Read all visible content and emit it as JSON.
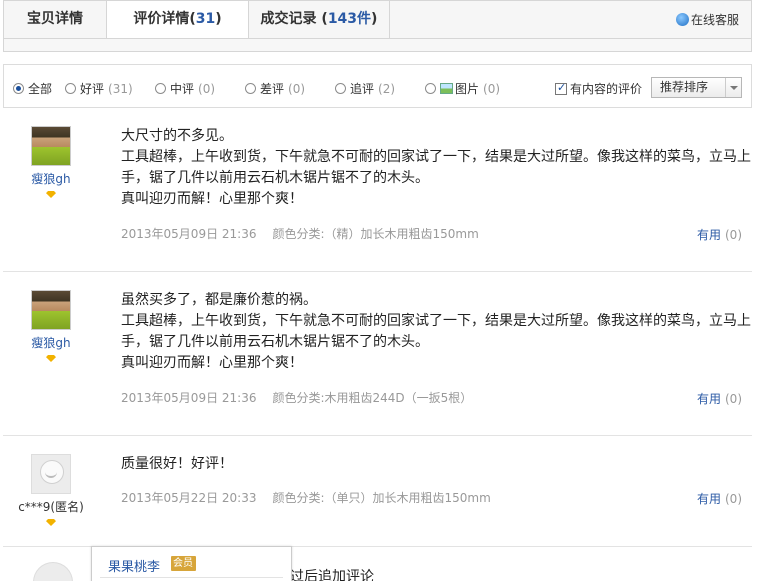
{
  "tabs": [
    {
      "label": "宝贝详情",
      "count": ""
    },
    {
      "label": "评价详情(",
      "count": "31",
      "suffix": ")"
    },
    {
      "label": "成交记录 (",
      "count": "143件",
      "suffix": ")"
    }
  ],
  "online_service": "在线客服",
  "filters": {
    "all": {
      "label": "全部",
      "count": ""
    },
    "good": {
      "label": "好评",
      "count": "(31)"
    },
    "mid": {
      "label": "中评",
      "count": "(0)"
    },
    "bad": {
      "label": "差评",
      "count": "(0)"
    },
    "append": {
      "label": "追评",
      "count": "(2)"
    },
    "pic": {
      "label": "图片",
      "count": "(0)"
    },
    "has_content": "有内容的评价",
    "sort": "推荐排序"
  },
  "reviews": [
    {
      "user": "瘦狼gh",
      "lines": [
        "大尺寸的不多见。",
        "工具超棒，上午收到货，下午就急不可耐的回家试了一下，结果是大过所望。像我这样的菜鸟，立马上手，锯了几件以前用云石机木锯片锯不了的木头。",
        "真叫迎刃而解！心里那个爽！"
      ],
      "date": "2013年05月09日 21:36",
      "spec": "颜色分类:（精）加长木用粗齿150mm",
      "useful_label": "有用",
      "useful_count": "(0)"
    },
    {
      "user": "瘦狼gh",
      "lines": [
        "虽然买多了，都是廉价惹的祸。",
        "工具超棒，上午收到货，下午就急不可耐的回家试了一下，结果是大过所望。像我这样的菜鸟，立马上手，锯了几件以前用云石机木锯片锯不了的木头。",
        "真叫迎刃而解！心里那个爽！"
      ],
      "date": "2013年05月09日 21:36",
      "spec": "颜色分类:木用粗齿244D（一扳5根）",
      "useful_label": "有用",
      "useful_count": "(0)"
    },
    {
      "user": "c***9(匿名)",
      "lines": [
        "质量很好！好评！"
      ],
      "date": "2013年05月22日 20:33",
      "spec": "颜色分类:（单只）加长木用粗齿150mm",
      "useful_label": "有用",
      "useful_count": "(0)"
    }
  ],
  "popup": {
    "name": "果果桃李",
    "badge": "会员"
  },
  "partial_text": "过后追加评论",
  "colors": {
    "link": "#2b5aa5",
    "muted": "#999999",
    "medal": "#f2b200"
  }
}
